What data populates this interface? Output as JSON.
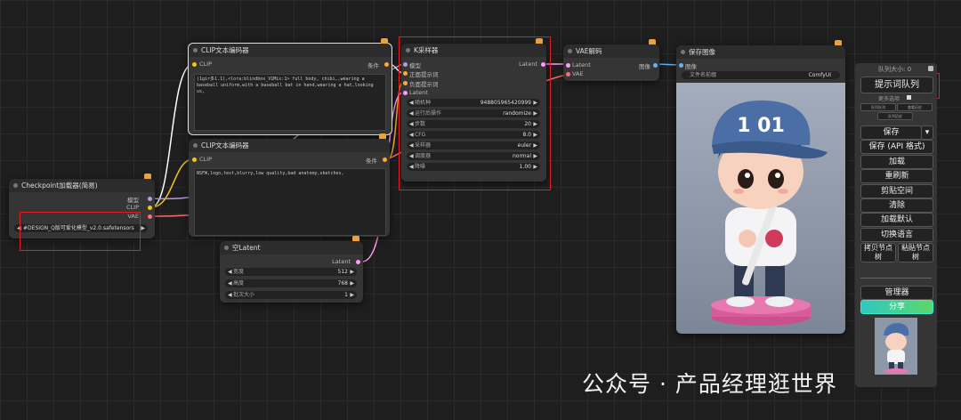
{
  "nodes": {
    "checkpoint": {
      "title": "Checkpoint加载器(简易)",
      "outputs": [
        "模型",
        "CLIP",
        "VAE"
      ],
      "ckpt_name": "#DESIGN_Q版可爱化模型_v2.0.safetensors"
    },
    "clip_pos": {
      "title": "CLIP文本编码器",
      "input": "CLIP",
      "output": "条件",
      "text": "(1gir多1.1),<lora:blindbox_V1Mix:1> full body, chibi,,wearing a baseball uniform,with a baseball bat in hand,wearing a hat,looking us,"
    },
    "clip_neg": {
      "title": "CLIP文本编码器",
      "input": "CLIP",
      "output": "条件",
      "text": "NSFW,logo,text,blurry,low quality,bad anatomy,sketches,"
    },
    "empty_latent": {
      "title": "空Latent",
      "output": "Latent",
      "widgets": [
        {
          "label": "宽度",
          "value": "512"
        },
        {
          "label": "高度",
          "value": "768"
        },
        {
          "label": "批次大小",
          "value": "1"
        }
      ]
    },
    "ksampler": {
      "title": "K采样器",
      "inputs": [
        "模型",
        "正面提示词",
        "负面提示词",
        "Latent"
      ],
      "output": "Latent",
      "widgets": [
        {
          "label": "随机种",
          "value": "948805965420999"
        },
        {
          "label": "运行后操作",
          "value": "randomize"
        },
        {
          "label": "步数",
          "value": "20"
        },
        {
          "label": "CFG",
          "value": "8.0"
        },
        {
          "label": "采样器",
          "value": "euler"
        },
        {
          "label": "调度器",
          "value": "normal"
        },
        {
          "label": "降噪",
          "value": "1.00"
        }
      ]
    },
    "vae_decode": {
      "title": "VAE解码",
      "inputs": [
        "Latent",
        "VAE"
      ],
      "output": "图像"
    },
    "save_image": {
      "title": "保存图像",
      "input": "图像",
      "filename_label": "文件名前缀",
      "filename_value": "ComfyUI",
      "image_text": "1 01"
    }
  },
  "panel": {
    "queue_size": "队列大小: 0",
    "queue_prompt": "提示词队列",
    "extra_options": "更多选项",
    "small_buttons": [
      "队列队列",
      "查看历史",
      "队列历史"
    ],
    "buttons": [
      "保存",
      "保存 (API 格式)",
      "加载",
      "重刷新",
      "剪贴空间",
      "清除",
      "加载默认",
      "切换语言"
    ],
    "copy_node": "拷贝节点树",
    "paste_node": "粘贴节点树",
    "manager": "管理器",
    "share": "分享",
    "save_dropdown": "▾"
  },
  "watermark": "公众号 · 产品经理逛世界",
  "colors": {
    "clip": "#f5c518",
    "model": "#b39ddb",
    "vae": "#ff6e6e",
    "latent": "#ff9cf9",
    "conditioning": "#ffa931",
    "image": "#64b5f6",
    "highlight": "#e02020"
  }
}
